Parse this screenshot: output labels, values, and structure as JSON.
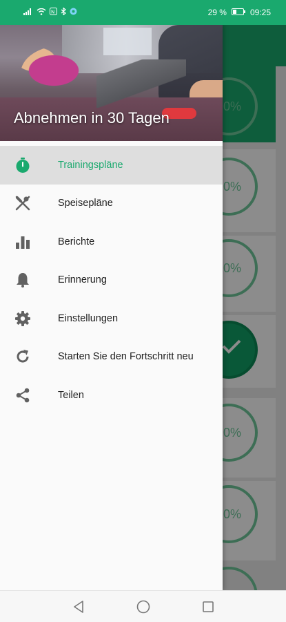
{
  "status_bar": {
    "battery_percent": "29 %",
    "time": "09:25",
    "icons": [
      "signal-icon",
      "wifi-icon",
      "nfc-icon",
      "bluetooth-icon",
      "vpn-icon",
      "battery-icon"
    ]
  },
  "drawer": {
    "header_title": "Abnehmen in 30 Tagen",
    "items": [
      {
        "label": "Trainingspläne",
        "icon": "stopwatch-icon",
        "active": true
      },
      {
        "label": "Speisepläne",
        "icon": "fork-knife-icon",
        "active": false
      },
      {
        "label": "Berichte",
        "icon": "bar-chart-icon",
        "active": false
      },
      {
        "label": "Erinnerung",
        "icon": "bell-icon",
        "active": false
      },
      {
        "label": "Einstellungen",
        "icon": "gear-icon",
        "active": false
      },
      {
        "label": "Starten Sie den Fortschritt neu",
        "icon": "refresh-icon",
        "active": false
      },
      {
        "label": "Teilen",
        "icon": "share-icon",
        "active": false
      }
    ]
  },
  "background": {
    "progress_labels": [
      "0%",
      "0%",
      "0%",
      "0%",
      "0%"
    ]
  },
  "nav_bar": {
    "buttons": [
      "back-icon",
      "home-icon",
      "recents-icon"
    ]
  },
  "colors": {
    "accent": "#1aa96e",
    "icon_gray": "#616161",
    "text": "#212121"
  }
}
